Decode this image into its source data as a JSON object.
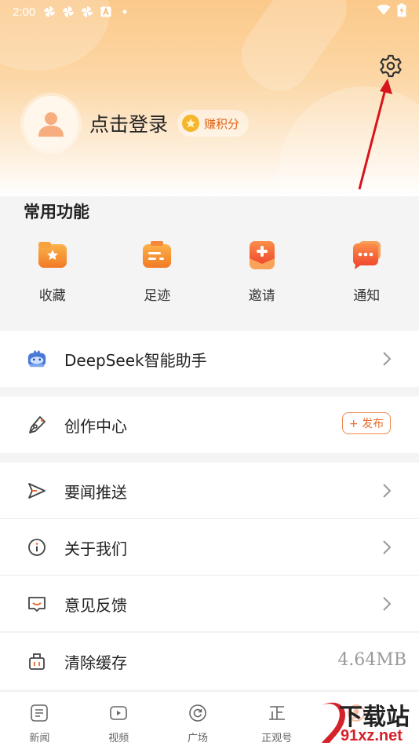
{
  "status_bar": {
    "time": "2:00",
    "icons": [
      "pinwheel-icon",
      "pinwheel-icon",
      "pinwheel-icon",
      "a-badge-icon",
      "dot-icon"
    ],
    "right_icons": [
      "wifi-icon",
      "battery-charging-icon"
    ]
  },
  "header": {
    "settings_icon": "gear-icon",
    "login_text": "点击登录",
    "points_label": "赚积分",
    "colors": {
      "top": "#fbc98a",
      "accent": "#e0651a"
    }
  },
  "functions": {
    "title": "常用功能",
    "items": [
      {
        "label": "收藏",
        "icon": "favorites-folder-icon"
      },
      {
        "label": "足迹",
        "icon": "history-folder-icon"
      },
      {
        "label": "邀请",
        "icon": "invite-plus-icon"
      },
      {
        "label": "通知",
        "icon": "notification-chat-icon"
      }
    ]
  },
  "menu": {
    "deepseek": {
      "label": "DeepSeek智能助手",
      "icon": "deepseek-whale-icon"
    },
    "creation": {
      "label": "创作中心",
      "icon": "pen-icon",
      "publish_label": "+ 发布"
    },
    "push": {
      "label": "要闻推送",
      "icon": "send-icon"
    },
    "about": {
      "label": "关于我们",
      "icon": "info-icon"
    },
    "feedback": {
      "label": "意见反馈",
      "icon": "feedback-icon"
    },
    "cache": {
      "label": "清除缓存",
      "icon": "trash-icon",
      "size": "4.64MB"
    }
  },
  "bottom_nav": {
    "items": [
      {
        "label": "新闻",
        "icon": "news-icon"
      },
      {
        "label": "视频",
        "icon": "video-icon"
      },
      {
        "label": "广场",
        "icon": "refresh-circle-icon"
      },
      {
        "label": "正观号",
        "icon": "zhengguan-icon"
      },
      {
        "label": "",
        "icon": "profile-icon"
      }
    ]
  },
  "watermark": {
    "line1": "下载站",
    "line2": "91xz.net"
  }
}
